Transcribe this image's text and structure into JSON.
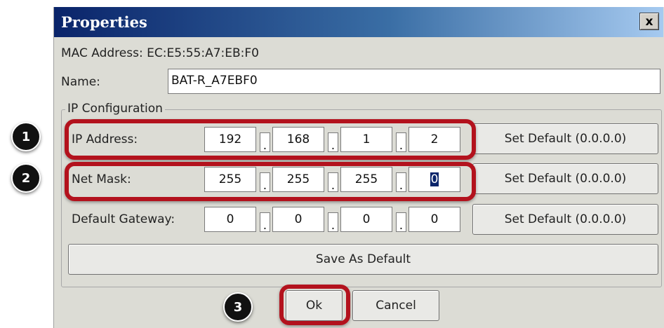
{
  "dialog": {
    "title": "Properties",
    "close_icon": "close-icon",
    "close_label": "x"
  },
  "mac": {
    "label": "MAC Address:",
    "value": "EC:E5:55:A7:EB:F0"
  },
  "name": {
    "label": "Name:",
    "value": "BAT-R_A7EBF0"
  },
  "ip_config": {
    "legend": "IP Configuration",
    "ip_address": {
      "label": "IP Address:",
      "octets": [
        "192",
        "168",
        "1",
        "2"
      ]
    },
    "net_mask": {
      "label": "Net Mask:",
      "octets": [
        "255",
        "255",
        "255",
        "0"
      ]
    },
    "default_gateway": {
      "label": "Default Gateway:",
      "octets": [
        "0",
        "0",
        "0",
        "0"
      ]
    },
    "dot": ".",
    "set_default_label": "Set Default (0.0.0.0)",
    "save_default_label": "Save As Default"
  },
  "buttons": {
    "ok": "Ok",
    "cancel": "Cancel"
  },
  "annotations": {
    "badges": [
      "1",
      "2",
      "3"
    ],
    "highlight_color": "#b3121d"
  }
}
